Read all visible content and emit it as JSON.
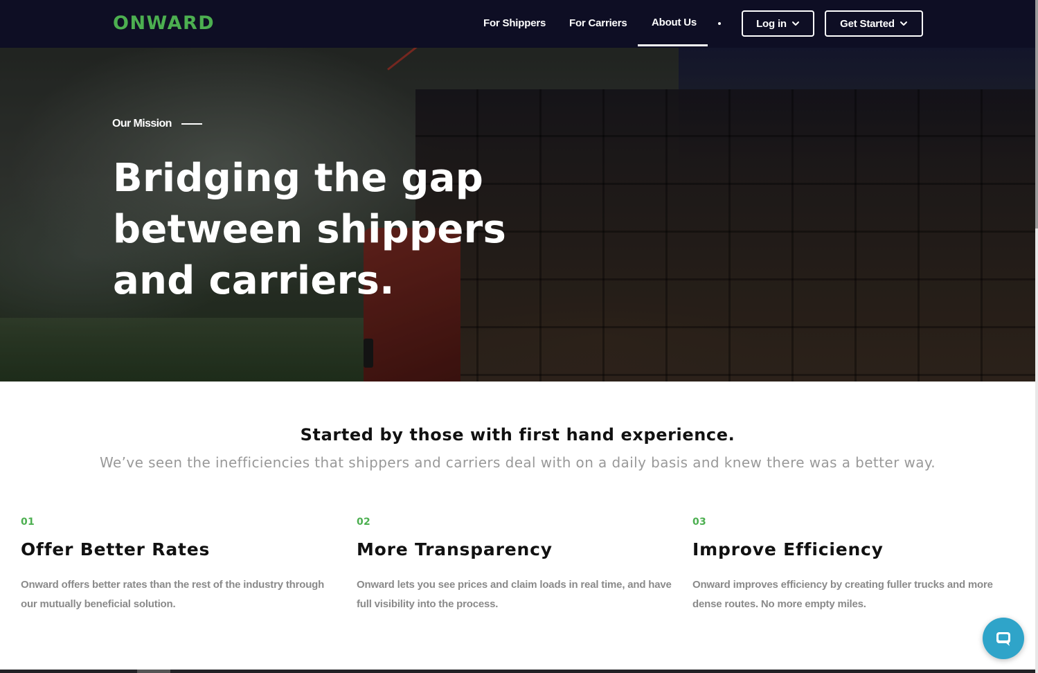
{
  "navbar": {
    "logo": "ONWARD",
    "links": {
      "shippers": "For Shippers",
      "carriers": "For Carriers",
      "about": "About Us"
    },
    "login_label": "Log in",
    "get_started_label": "Get Started"
  },
  "hero": {
    "eyebrow": "Our Mission",
    "title": "Bridging the gap between shippers and carriers."
  },
  "intro": {
    "title": "Started by those with first hand experience.",
    "subtitle": "We’ve seen the inefficiencies that shippers and carriers deal with on a daily basis and knew there was a better way."
  },
  "features": [
    {
      "number": "01",
      "title": "Offer Better Rates",
      "text": "Onward offers better rates than the rest of the industry through our mutually beneficial solution."
    },
    {
      "number": "02",
      "title": "More Transparency",
      "text": "Onward lets you see prices and claim loads in real time, and have full visibility into the process."
    },
    {
      "number": "03",
      "title": "Improve Efficiency",
      "text": "Onward improves efficiency by creating fuller trucks and more dense routes. No more empty miles."
    }
  ],
  "icons": {
    "dropdown": "chevron-down-icon",
    "chat": "chat-bubble-icon"
  },
  "colors": {
    "navbar_bg": "#0e0e24",
    "brand_green": "#4caf50",
    "chat_accent": "#2fa4c9",
    "muted_text": "#8a8a8a"
  }
}
